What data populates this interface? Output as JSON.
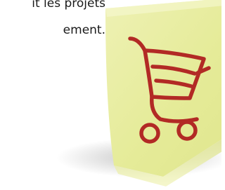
{
  "text_fragment": {
    "line1": "it les projets",
    "line2": "ement."
  },
  "illustration": {
    "note_color": "#e9eea0",
    "ink_color": "#b22a25",
    "icon": "shopping-cart-icon"
  }
}
